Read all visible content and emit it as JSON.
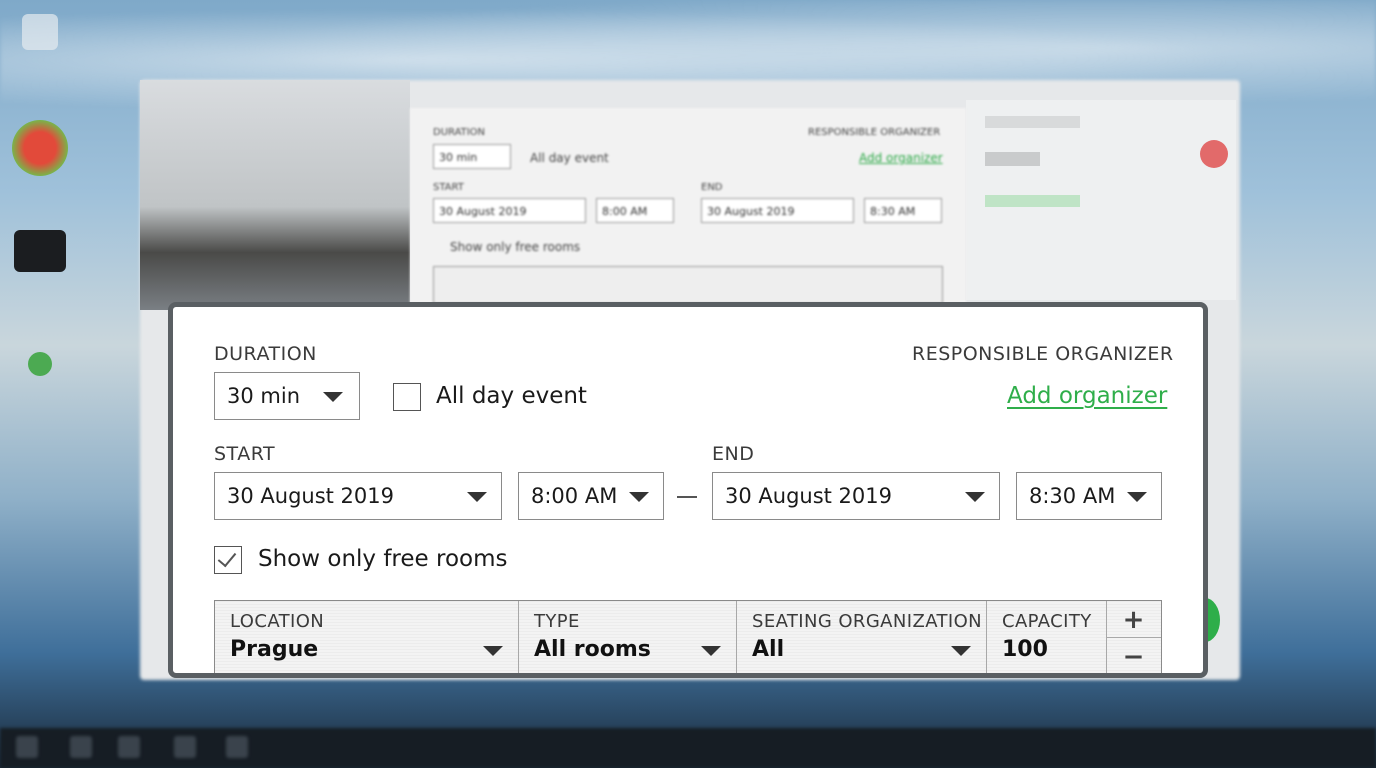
{
  "form": {
    "duration_label": "DURATION",
    "duration_value": "30 min",
    "all_day_label": "All day event",
    "all_day_checked": false,
    "organizer_label": "RESPONSIBLE ORGANIZER",
    "add_organizer": "Add organizer",
    "start_label": "START",
    "start_date": "30 August 2019",
    "start_time": "8:00 AM",
    "end_label": "END",
    "end_date": "30 August 2019",
    "end_time": "8:30 AM",
    "free_rooms_label": "Show only free rooms",
    "free_rooms_checked": true
  },
  "filters": {
    "location_label": "LOCATION",
    "location_value": "Prague",
    "type_label": "TYPE",
    "type_value": "All rooms",
    "seating_label": "SEATING ORGANIZATION",
    "seating_value": "All",
    "capacity_label": "CAPACITY",
    "capacity_value": "100",
    "increment": "+",
    "decrement": "−"
  },
  "colors": {
    "link_green": "#2fae4a",
    "panel_border": "#5a5f63"
  }
}
